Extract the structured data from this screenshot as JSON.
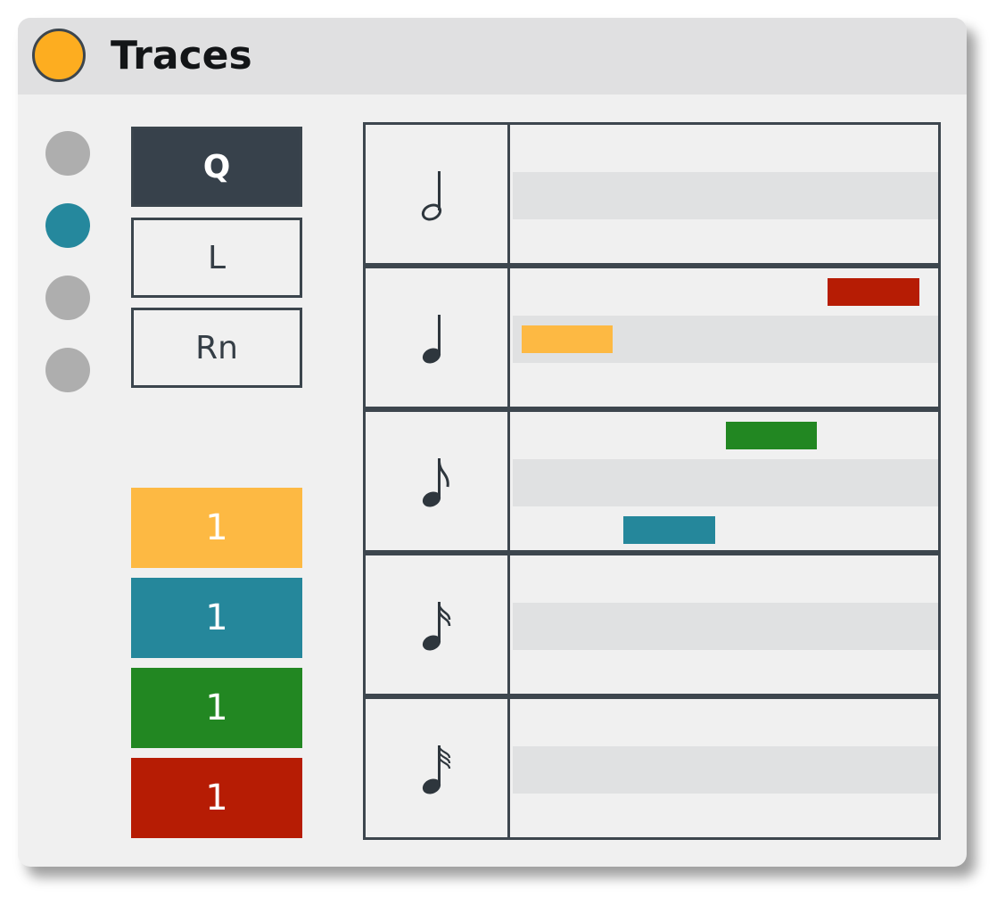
{
  "window": {
    "title": "Traces",
    "title_dot_color": "#fdad20"
  },
  "leds": [
    {
      "state": "off",
      "color": "#aeaeae"
    },
    {
      "state": "on",
      "color": "#25889d"
    },
    {
      "state": "off",
      "color": "#aeaeae"
    },
    {
      "state": "off",
      "color": "#aeaeae"
    }
  ],
  "mode_buttons": [
    {
      "label": "Q",
      "active": true
    },
    {
      "label": "L",
      "active": false
    },
    {
      "label": "Rn",
      "active": false
    }
  ],
  "trace_counts": [
    {
      "label": "1",
      "color": "#fdb943"
    },
    {
      "label": "1",
      "color": "#25879b"
    },
    {
      "label": "1",
      "color": "#228722"
    },
    {
      "label": "1",
      "color": "#b61c04"
    }
  ],
  "note_rows": [
    {
      "note": "half-note-icon",
      "lanes": [
        {
          "bars": []
        },
        {
          "bars": []
        },
        {
          "bars": []
        }
      ]
    },
    {
      "note": "quarter-note-icon",
      "lanes": [
        {
          "bars": [
            {
              "start": 0.74,
              "length": 0.215,
              "color": "#b61c04"
            }
          ]
        },
        {
          "bars": [
            {
              "start": 0.02,
              "length": 0.215,
              "color": "#fdb943"
            }
          ]
        },
        {
          "bars": []
        }
      ]
    },
    {
      "note": "eighth-note-icon",
      "lanes": [
        {
          "bars": [
            {
              "start": 0.5,
              "length": 0.215,
              "color": "#228722"
            }
          ]
        },
        {
          "bars": []
        },
        {
          "bars": [
            {
              "start": 0.26,
              "length": 0.215,
              "color": "#25879b"
            }
          ]
        }
      ]
    },
    {
      "note": "sixteenth-note-icon",
      "lanes": [
        {
          "bars": []
        },
        {
          "bars": []
        },
        {
          "bars": []
        }
      ]
    },
    {
      "note": "thirty-second-note-icon",
      "lanes": [
        {
          "bars": []
        },
        {
          "bars": []
        },
        {
          "bars": []
        }
      ]
    }
  ]
}
